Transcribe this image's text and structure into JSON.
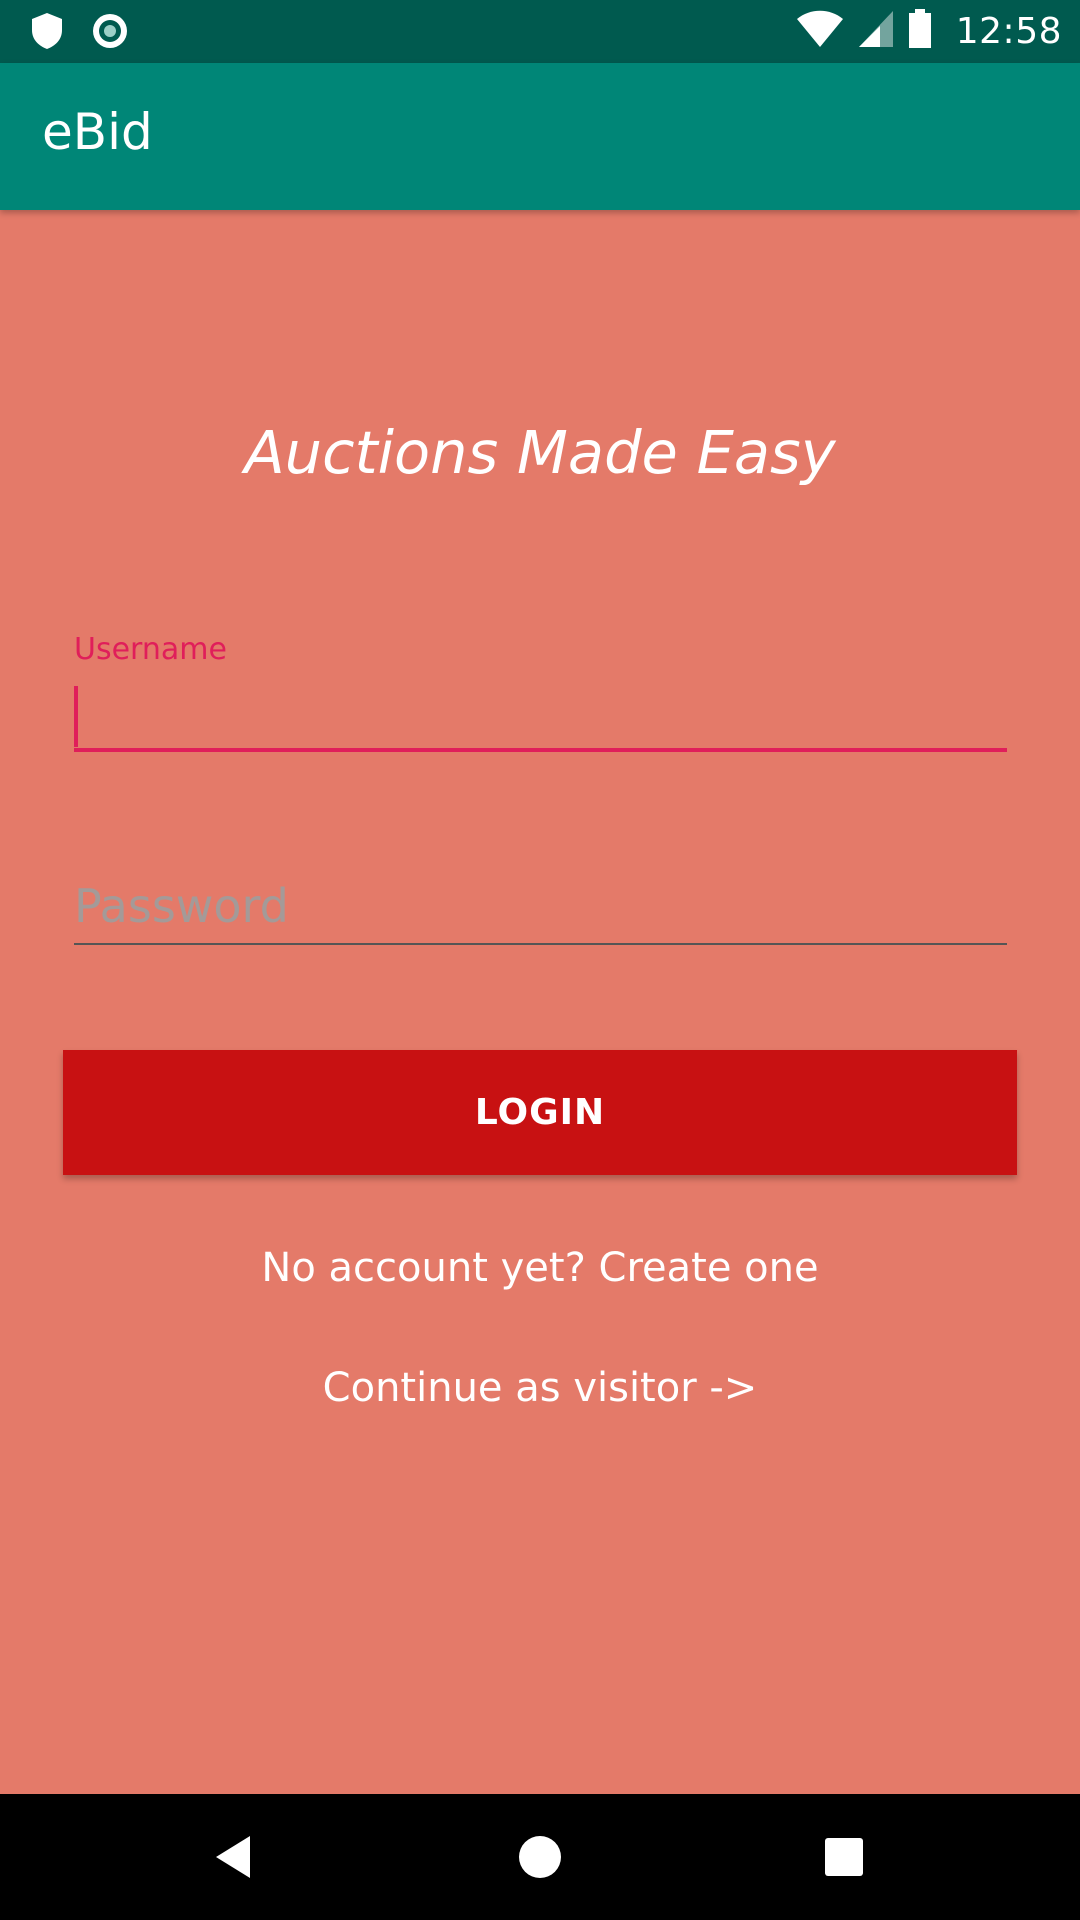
{
  "status_bar": {
    "time": "12:58",
    "icons": [
      "shield-icon",
      "sync-icon",
      "wifi-icon",
      "signal-icon",
      "battery-icon"
    ]
  },
  "app_bar": {
    "title": "eBid"
  },
  "tagline": "Auctions Made Easy",
  "form": {
    "username_label": "Username",
    "username_value": "",
    "password_placeholder": "Password",
    "password_value": "",
    "login_label": "LOGIN"
  },
  "links": {
    "create_account": "No account yet? Create one",
    "continue_visitor": "Continue as visitor ->"
  },
  "nav_bar": {
    "icons": [
      "back-icon",
      "home-icon",
      "recents-icon"
    ]
  },
  "colors": {
    "status_bar": "#005a4f",
    "app_bar": "#008677",
    "background": "#e47a69",
    "accent": "#e01e5a",
    "login_button": "#c81112"
  }
}
